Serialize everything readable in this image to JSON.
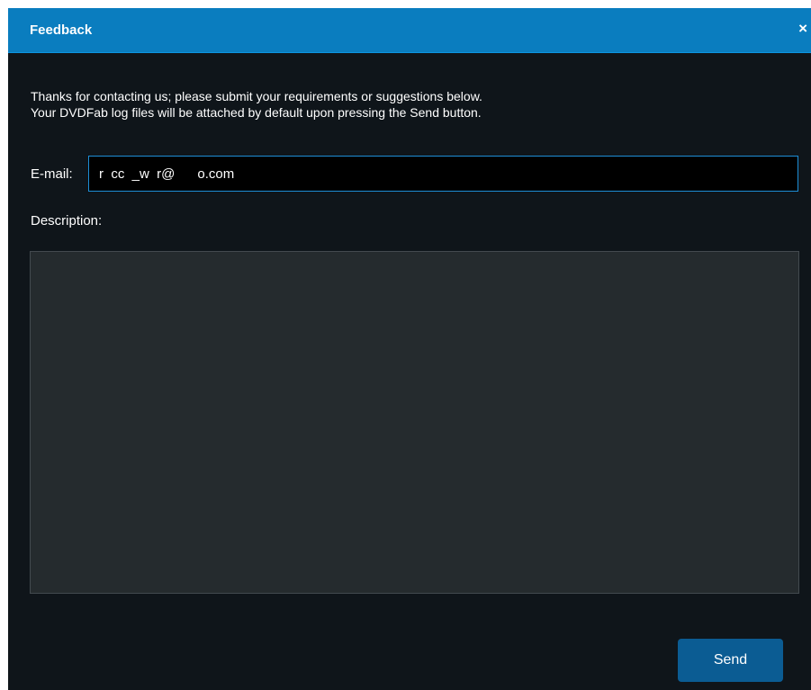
{
  "dialog": {
    "title": "Feedback",
    "close_icon": "close-icon",
    "close_glyph": "×"
  },
  "intro": {
    "line1": "Thanks for contacting us; please submit your requirements or suggestions below.",
    "line2": "Your DVDFab log files will be attached by default upon pressing the Send button."
  },
  "form": {
    "email_label": "E-mail:",
    "email_value": "r  cc  _w  r@      o.com",
    "description_label": "Description:",
    "description_value": ""
  },
  "actions": {
    "send_label": "Send"
  },
  "colors": {
    "titlebar": "#0a7dbf",
    "background": "#0f151a",
    "textarea": "#252b2e",
    "send_button": "#0b5c93",
    "input_border": "#1d8ed6"
  }
}
